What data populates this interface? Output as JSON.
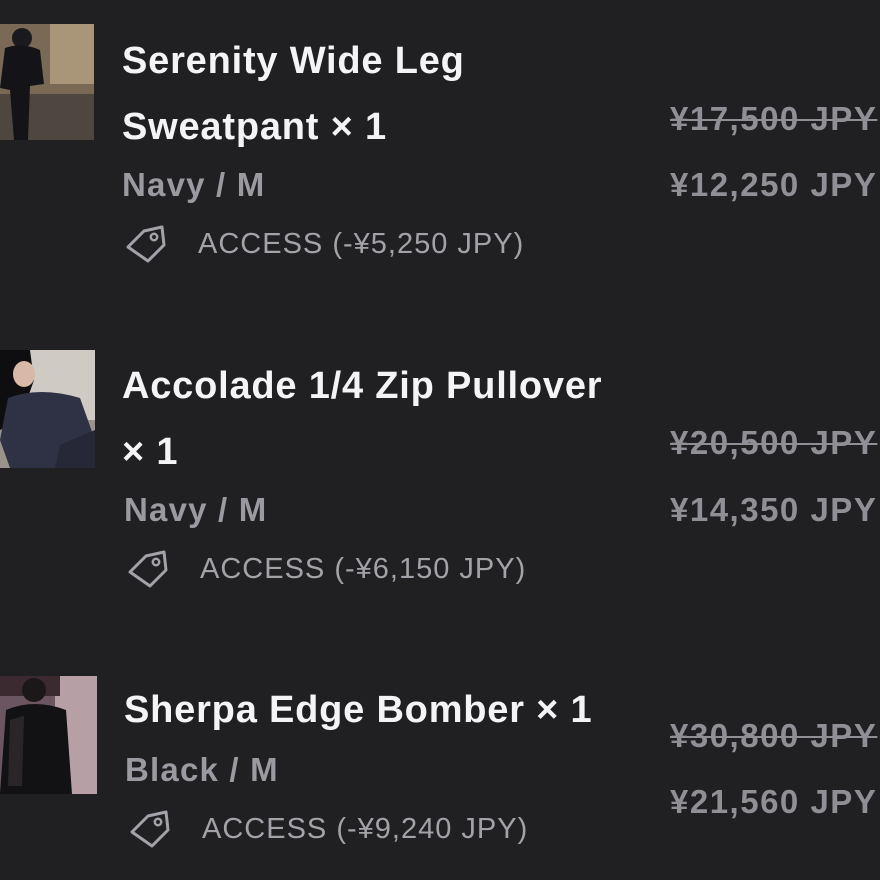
{
  "items": [
    {
      "title_line1": "Serenity Wide Leg",
      "title_line2": "Sweatpant × 1",
      "variant": "Navy / M",
      "discount": "ACCESS (-¥5,250 JPY)",
      "original_price": "¥17,500 JPY",
      "sale_price": "¥12,250 JPY"
    },
    {
      "title_line1": "Accolade 1/4 Zip Pullover",
      "title_line2": "× 1",
      "variant": "Navy / M",
      "discount": "ACCESS (-¥6,150 JPY)",
      "original_price": "¥20,500 JPY",
      "sale_price": "¥14,350 JPY"
    },
    {
      "title_line1": "Sherpa Edge Bomber × 1",
      "variant": "Black / M",
      "discount": "ACCESS (-¥9,240 JPY)",
      "original_price": "¥30,800 JPY",
      "sale_price": "¥21,560 JPY"
    }
  ],
  "icons": {
    "discount": "tag-icon",
    "thumbnail": "product-image"
  },
  "colors": {
    "background": "#202023",
    "title": "#f4f4f6",
    "muted": "#9a9aa0"
  }
}
